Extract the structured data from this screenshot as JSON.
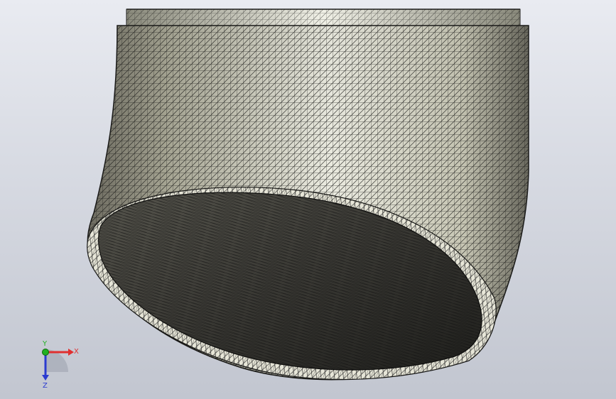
{
  "viewport": {
    "background_top": "#e9ebf1",
    "background_bottom": "#c2c6d0",
    "display_mode": "shaded-with-edges"
  },
  "model": {
    "body_color": "#cfcfbf",
    "mesh_color": "#222222",
    "cap_color": "#3a3a36",
    "rim_color": "#efefe2"
  },
  "triad": {
    "x_label": "X",
    "y_label": "Y",
    "z_label": "Z",
    "x_color": "#e03030",
    "y_color": "#20b020",
    "z_color": "#2b3bd0"
  }
}
